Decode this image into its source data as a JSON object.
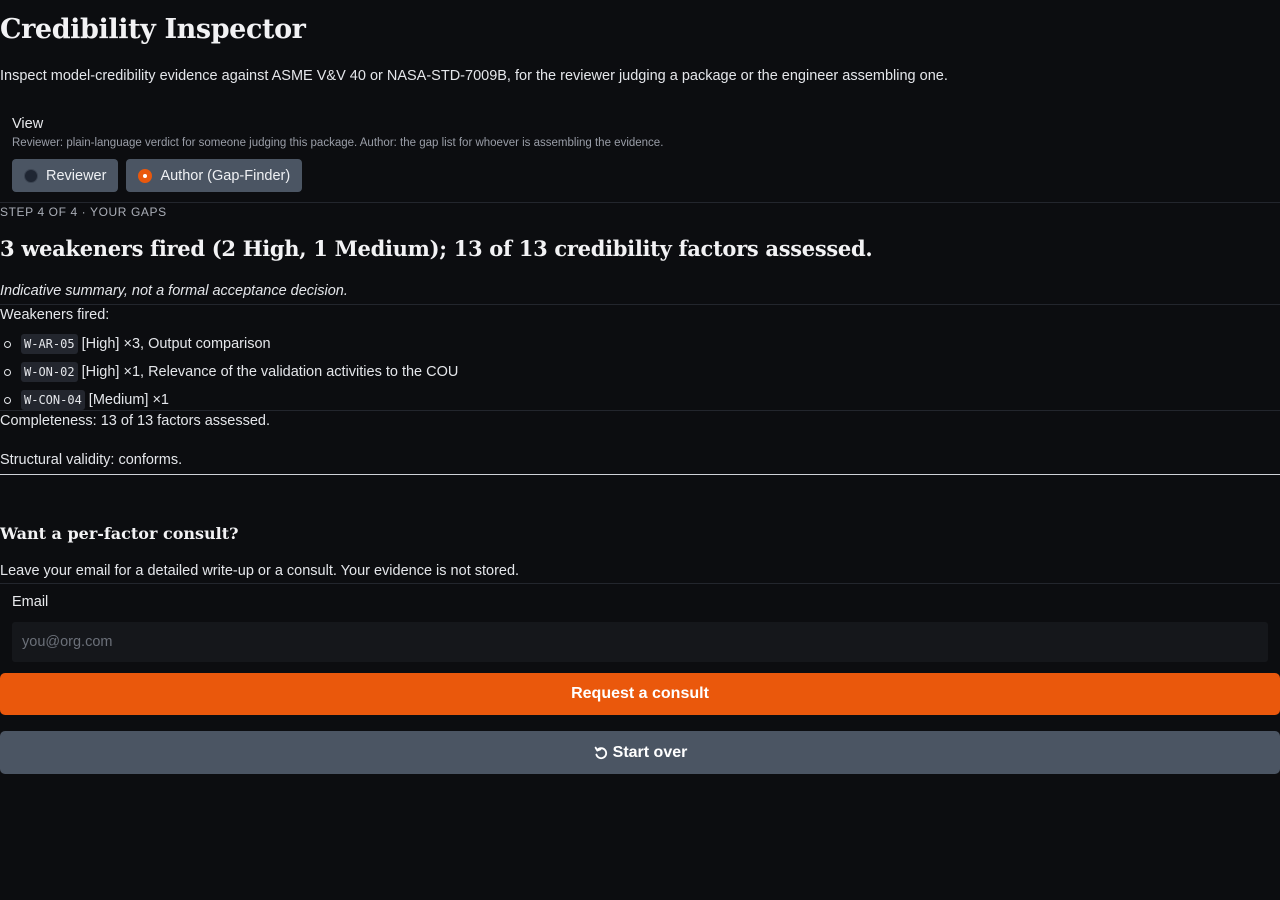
{
  "header": {
    "title": "Credibility Inspector",
    "subtitle": "Inspect model-credibility evidence against ASME V&V 40 or NASA-STD-7009B, for the reviewer judging a package or the engineer assembling one."
  },
  "view": {
    "label": "View",
    "help": "Reviewer: plain-language verdict for someone judging this package. Author: the gap list for whoever is assembling the evidence.",
    "options": [
      {
        "label": "Reviewer",
        "selected": false
      },
      {
        "label": "Author (Gap-Finder)",
        "selected": true
      }
    ]
  },
  "results": {
    "step_label": "STEP 4 OF 4 · YOUR GAPS",
    "headline": "3 weakeners fired (2 High, 1 Medium); 13 of 13 credibility factors assessed.",
    "disclaimer": "Indicative summary, not a formal acceptance decision.",
    "weakeners_title": "Weakeners fired:",
    "weakeners": [
      {
        "code": "W-AR-05",
        "text": "[High] ×3, Output comparison"
      },
      {
        "code": "W-ON-02",
        "text": "[High] ×1, Relevance of the validation activities to the COU"
      },
      {
        "code": "W-CON-04",
        "text": "[Medium] ×1"
      }
    ],
    "completeness": "Completeness: 13 of 13 factors assessed.",
    "structural": "Structural validity: conforms."
  },
  "consult": {
    "title": "Want a per-factor consult?",
    "text": "Leave your email for a detailed write-up or a consult. Your evidence is not stored.",
    "email_label": "Email",
    "email_placeholder": "you@org.com",
    "email_value": "",
    "request_button": "Request a consult",
    "start_over_button": "Start over"
  },
  "colors": {
    "accent": "#ea580c",
    "secondary_button": "#4b5563",
    "background": "#0c0d10"
  },
  "icons": {
    "start_over": "restart-icon"
  }
}
